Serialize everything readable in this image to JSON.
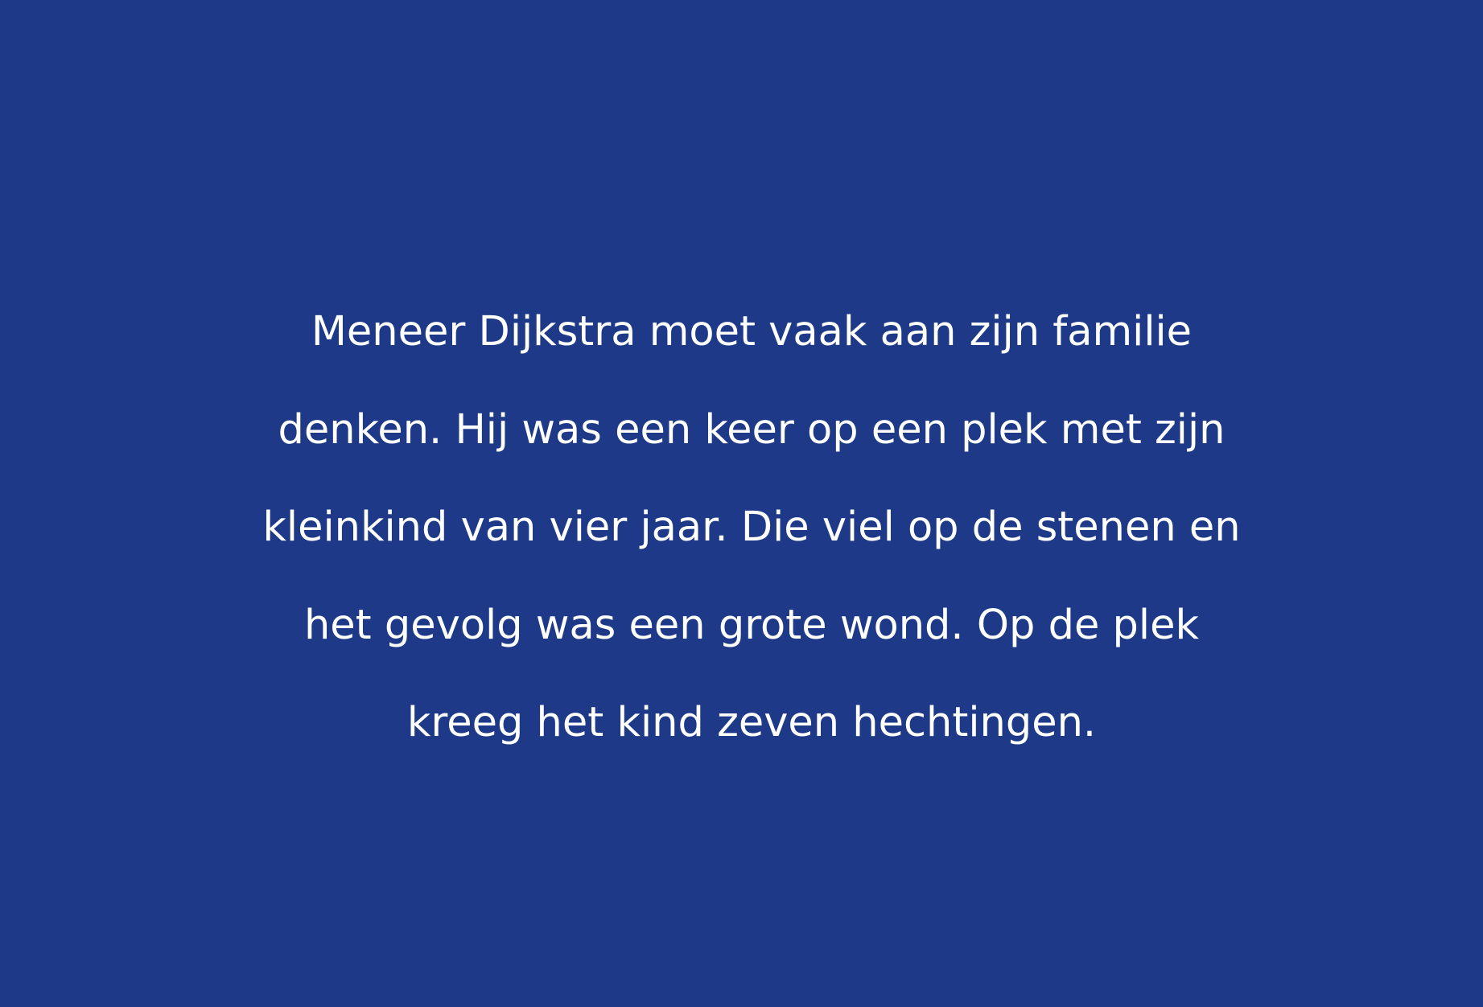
{
  "slide": {
    "background_color": "#1e3988",
    "text_color": "#ffffff",
    "lines": [
      "Meneer Dijkstra moet vaak aan zijn familie",
      "denken. Hij was een keer op een plek met zijn",
      "kleinkind van vier jaar. Die viel op de stenen en",
      "het gevolg was een grote wond. Op de plek",
      "kreeg het kind zeven hechtingen."
    ]
  }
}
